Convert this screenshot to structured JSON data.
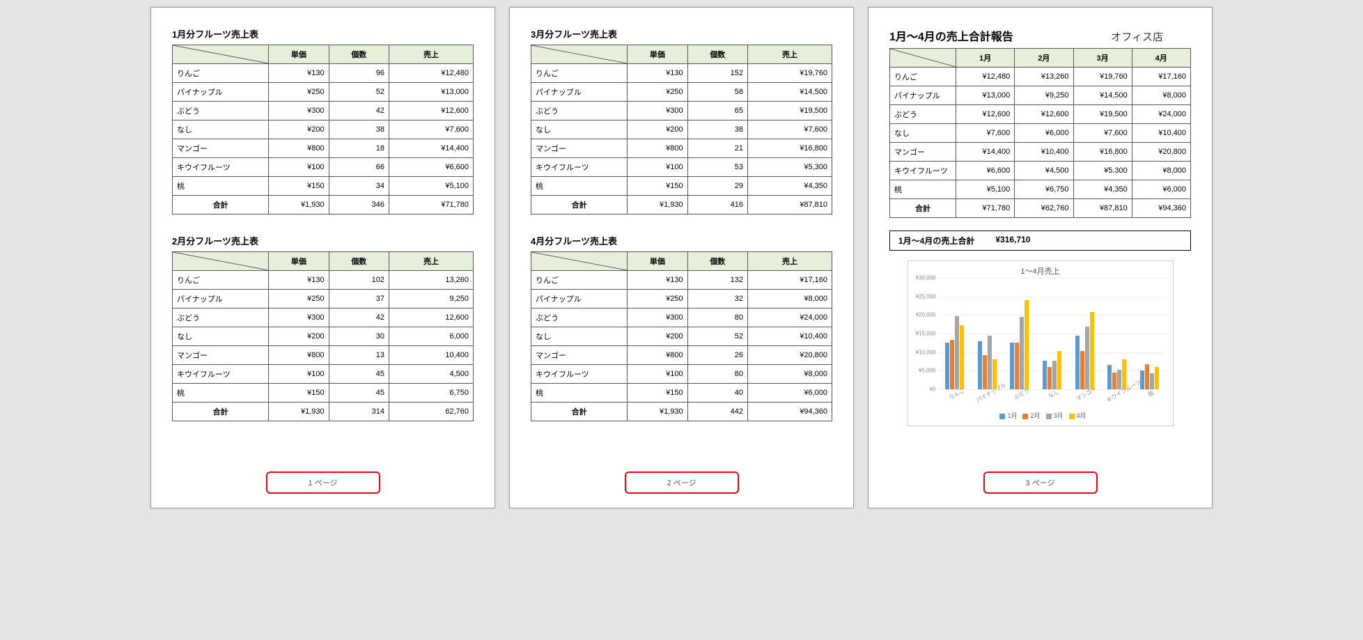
{
  "headers": {
    "price": "単価",
    "qty": "個数",
    "sales": "売上"
  },
  "total_label": "合計",
  "page_labels": [
    "1 ページ",
    "2 ページ",
    "3 ページ"
  ],
  "monthly_tables": [
    {
      "title": "1月分フルーツ売上表",
      "rows": [
        {
          "name": "りんご",
          "price": "¥130",
          "qty": "96",
          "sales": "¥12,480"
        },
        {
          "name": "パイナップル",
          "price": "¥250",
          "qty": "52",
          "sales": "¥13,000"
        },
        {
          "name": "ぶどう",
          "price": "¥300",
          "qty": "42",
          "sales": "¥12,600"
        },
        {
          "name": "なし",
          "price": "¥200",
          "qty": "38",
          "sales": "¥7,600"
        },
        {
          "name": "マンゴー",
          "price": "¥800",
          "qty": "18",
          "sales": "¥14,400"
        },
        {
          "name": "キウイフルーツ",
          "price": "¥100",
          "qty": "66",
          "sales": "¥6,600"
        },
        {
          "name": "桃",
          "price": "¥150",
          "qty": "34",
          "sales": "¥5,100"
        }
      ],
      "totals": {
        "price": "¥1,930",
        "qty": "346",
        "sales": "¥71,780"
      }
    },
    {
      "title": "2月分フルーツ売上表",
      "rows": [
        {
          "name": "りんご",
          "price": "¥130",
          "qty": "102",
          "sales": "13,260"
        },
        {
          "name": "パイナップル",
          "price": "¥250",
          "qty": "37",
          "sales": "9,250"
        },
        {
          "name": "ぶどう",
          "price": "¥300",
          "qty": "42",
          "sales": "12,600"
        },
        {
          "name": "なし",
          "price": "¥200",
          "qty": "30",
          "sales": "6,000"
        },
        {
          "name": "マンゴー",
          "price": "¥800",
          "qty": "13",
          "sales": "10,400"
        },
        {
          "name": "キウイフルーツ",
          "price": "¥100",
          "qty": "45",
          "sales": "4,500"
        },
        {
          "name": "桃",
          "price": "¥150",
          "qty": "45",
          "sales": "6,750"
        }
      ],
      "totals": {
        "price": "¥1,930",
        "qty": "314",
        "sales": "62,760"
      }
    },
    {
      "title": "3月分フルーツ売上表",
      "rows": [
        {
          "name": "りんご",
          "price": "¥130",
          "qty": "152",
          "sales": "¥19,760"
        },
        {
          "name": "パイナップル",
          "price": "¥250",
          "qty": "58",
          "sales": "¥14,500"
        },
        {
          "name": "ぶどう",
          "price": "¥300",
          "qty": "65",
          "sales": "¥19,500"
        },
        {
          "name": "なし",
          "price": "¥200",
          "qty": "38",
          "sales": "¥7,600"
        },
        {
          "name": "マンゴー",
          "price": "¥800",
          "qty": "21",
          "sales": "¥16,800"
        },
        {
          "name": "キウイフルーツ",
          "price": "¥100",
          "qty": "53",
          "sales": "¥5,300"
        },
        {
          "name": "桃",
          "price": "¥150",
          "qty": "29",
          "sales": "¥4,350"
        }
      ],
      "totals": {
        "price": "¥1,930",
        "qty": "416",
        "sales": "¥87,810"
      }
    },
    {
      "title": "4月分フルーツ売上表",
      "rows": [
        {
          "name": "りんご",
          "price": "¥130",
          "qty": "132",
          "sales": "¥17,160"
        },
        {
          "name": "パイナップル",
          "price": "¥250",
          "qty": "32",
          "sales": "¥8,000"
        },
        {
          "name": "ぶどう",
          "price": "¥300",
          "qty": "80",
          "sales": "¥24,000"
        },
        {
          "name": "なし",
          "price": "¥200",
          "qty": "52",
          "sales": "¥10,400"
        },
        {
          "name": "マンゴー",
          "price": "¥800",
          "qty": "26",
          "sales": "¥20,800"
        },
        {
          "name": "キウイフルーツ",
          "price": "¥100",
          "qty": "80",
          "sales": "¥8,000"
        },
        {
          "name": "桃",
          "price": "¥150",
          "qty": "40",
          "sales": "¥6,000"
        }
      ],
      "totals": {
        "price": "¥1,930",
        "qty": "442",
        "sales": "¥94,360"
      }
    }
  ],
  "summary": {
    "title": "1月～4月の売上合計報告",
    "store": "オフィス店",
    "months": [
      "1月",
      "2月",
      "3月",
      "4月"
    ],
    "rows": [
      {
        "name": "りんご",
        "v": [
          "¥12,480",
          "¥13,260",
          "¥19,760",
          "¥17,160"
        ]
      },
      {
        "name": "パイナップル",
        "v": [
          "¥13,000",
          "¥9,250",
          "¥14,500",
          "¥8,000"
        ]
      },
      {
        "name": "ぶどう",
        "v": [
          "¥12,600",
          "¥12,600",
          "¥19,500",
          "¥24,000"
        ]
      },
      {
        "name": "なし",
        "v": [
          "¥7,600",
          "¥6,000",
          "¥7,600",
          "¥10,400"
        ]
      },
      {
        "name": "マンゴー",
        "v": [
          "¥14,400",
          "¥10,400",
          "¥16,800",
          "¥20,800"
        ]
      },
      {
        "name": "キウイフルーツ",
        "v": [
          "¥6,600",
          "¥4,500",
          "¥5,300",
          "¥8,000"
        ]
      },
      {
        "name": "桃",
        "v": [
          "¥5,100",
          "¥6,750",
          "¥4,350",
          "¥6,000"
        ]
      }
    ],
    "totals": [
      "¥71,780",
      "¥62,760",
      "¥87,810",
      "¥94,360"
    ],
    "grand_total_label": "1月～4月の売上合計",
    "grand_total_value": "¥316,710"
  },
  "chart_data": {
    "type": "bar",
    "title": "1～4月売上",
    "categories": [
      "りんご",
      "パイナップル",
      "ぶどう",
      "なし",
      "マンゴー",
      "キウイフルーツ",
      "桃"
    ],
    "series": [
      {
        "name": "1月",
        "color": "#5b9bd5",
        "values": [
          12480,
          13000,
          12600,
          7600,
          14400,
          6600,
          5100
        ]
      },
      {
        "name": "2月",
        "color": "#ed7d31",
        "values": [
          13260,
          9250,
          12600,
          6000,
          10400,
          4500,
          6750
        ]
      },
      {
        "name": "3月",
        "color": "#a5a5a5",
        "values": [
          19760,
          14500,
          19500,
          7600,
          16800,
          5300,
          4350
        ]
      },
      {
        "name": "4月",
        "color": "#ffc000",
        "values": [
          17160,
          8000,
          24000,
          10400,
          20800,
          8000,
          6000
        ]
      }
    ],
    "ylabel_prefix": "¥",
    "ylim": [
      0,
      30000
    ],
    "ystep": 5000
  }
}
